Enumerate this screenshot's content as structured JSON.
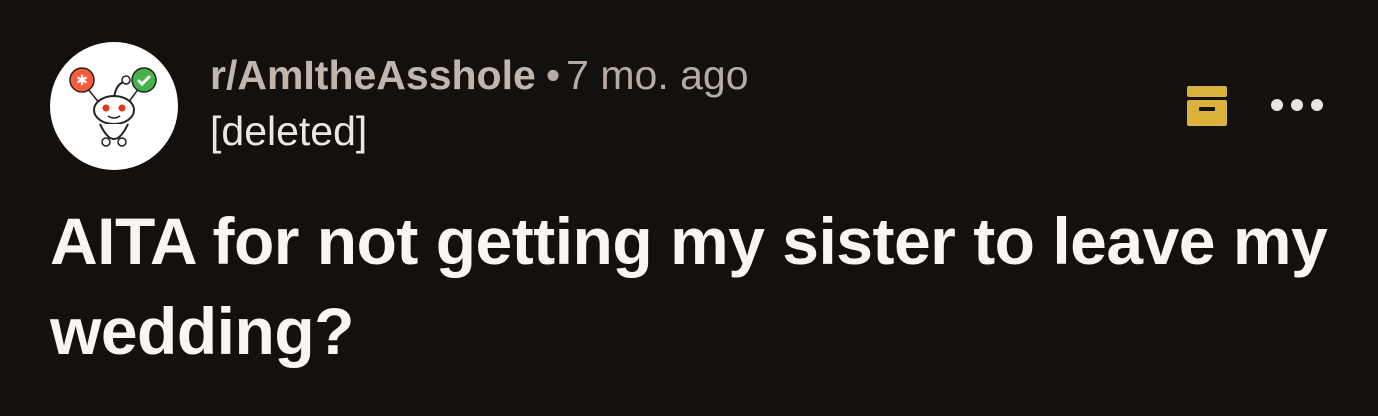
{
  "post": {
    "subreddit": "r/AmItheAsshole",
    "separator": "•",
    "timestamp": "7 mo. ago",
    "author": "[deleted]",
    "title": "AITA for not getting my sister to leave my wedding?"
  },
  "icons": {
    "avatar": "subreddit-avatar-icon",
    "archive": "archive-icon",
    "more": "more-options-icon"
  },
  "colors": {
    "background": "#14100e",
    "archive": "#d9b13b",
    "title": "#f8f5f2",
    "meta": "#b7aca3"
  }
}
